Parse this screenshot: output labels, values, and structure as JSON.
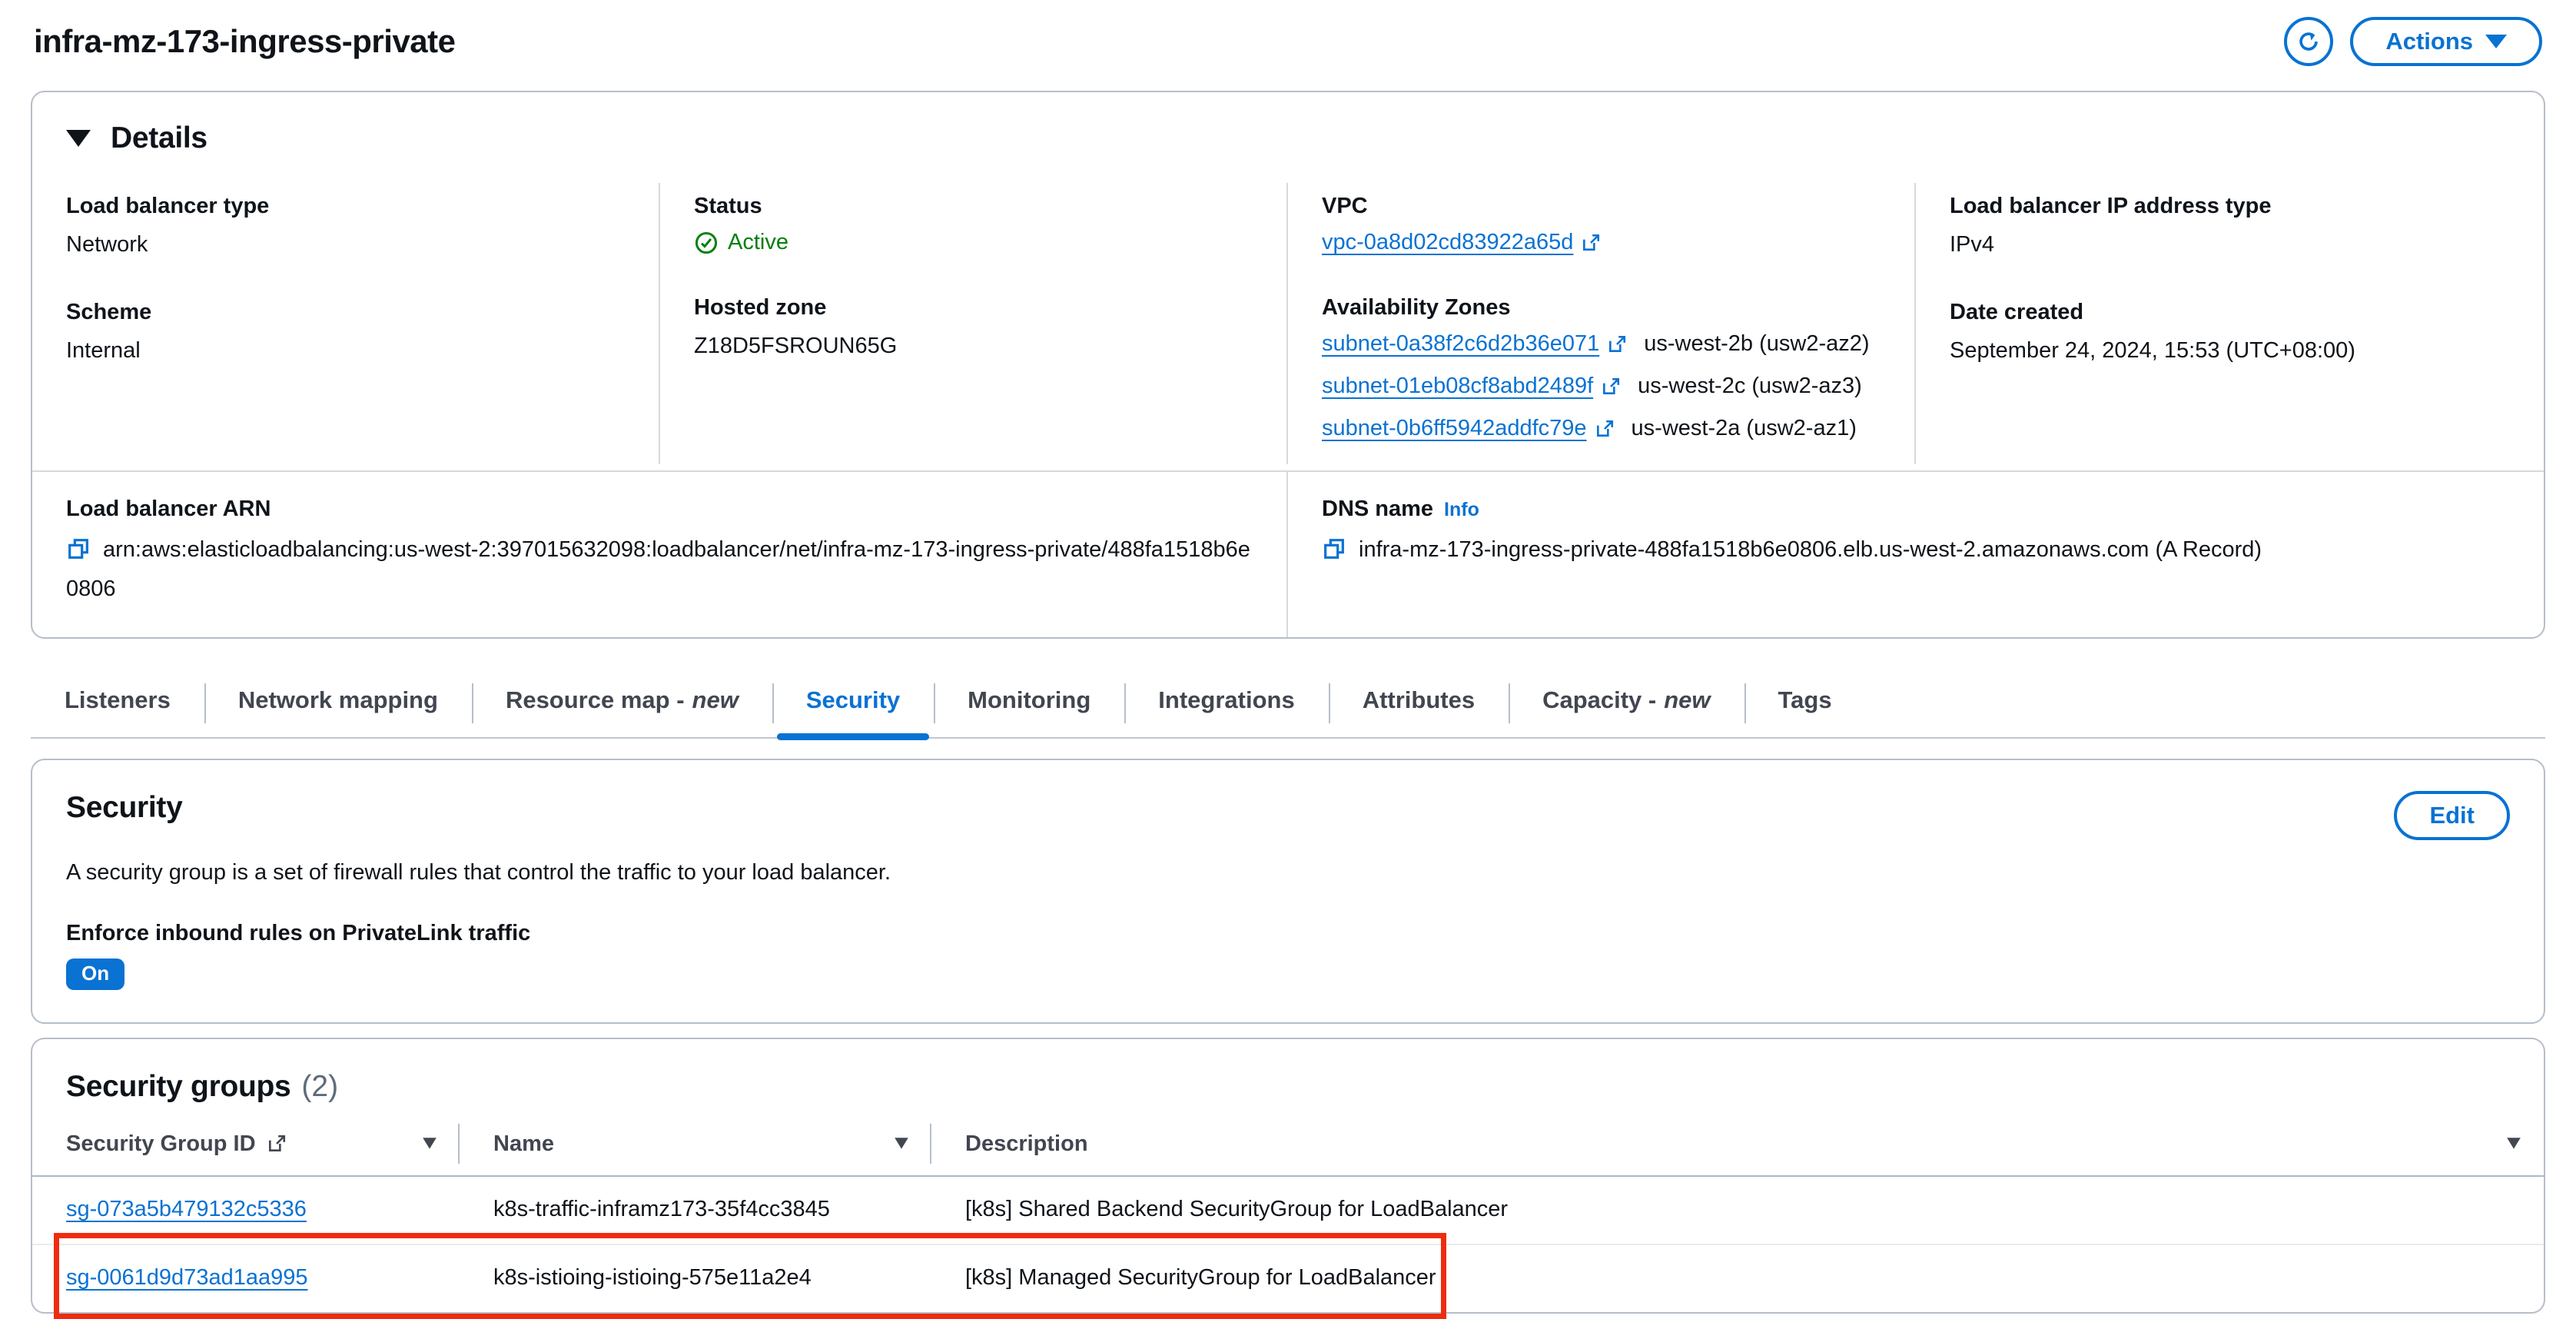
{
  "page": {
    "title": "infra-mz-173-ingress-private"
  },
  "toolbar": {
    "actions_label": "Actions"
  },
  "icons": {
    "refresh": "refresh-icon",
    "caret_down": "caret-down-icon",
    "collapse_triangle": "triangle-down-icon",
    "status_check": "check-circle-icon",
    "external_link": "external-link-icon",
    "copy": "copy-icon",
    "sort": "sort-triangle-icon"
  },
  "colors": {
    "accent_blue": "#0972d3",
    "status_green": "#037f0c",
    "annotation_red": "#ee2d10"
  },
  "details": {
    "title": "Details",
    "load_balancer_type": {
      "label": "Load balancer type",
      "value": "Network"
    },
    "scheme": {
      "label": "Scheme",
      "value": "Internal"
    },
    "status": {
      "label": "Status",
      "value": "Active"
    },
    "hosted_zone": {
      "label": "Hosted zone",
      "value": "Z18D5FSROUN65G"
    },
    "vpc": {
      "label": "VPC",
      "link": "vpc-0a8d02cd83922a65d"
    },
    "availability_zones": {
      "label": "Availability Zones",
      "items": [
        {
          "subnet": "subnet-0a38f2c6d2b36e071",
          "zone": "us-west-2b (usw2-az2)"
        },
        {
          "subnet": "subnet-01eb08cf8abd2489f",
          "zone": "us-west-2c (usw2-az3)"
        },
        {
          "subnet": "subnet-0b6ff5942addfc79e",
          "zone": "us-west-2a (usw2-az1)"
        }
      ]
    },
    "ip_address_type": {
      "label": "Load balancer IP address type",
      "value": "IPv4"
    },
    "date_created": {
      "label": "Date created",
      "value": "September 24, 2024, 15:53 (UTC+08:00)"
    },
    "arn": {
      "label": "Load balancer ARN",
      "value": "arn:aws:elasticloadbalancing:us-west-2:397015632098:loadbalancer/net/infra-mz-173-ingress-private/488fa1518b6e0806"
    },
    "dns": {
      "label": "DNS name",
      "info": "Info",
      "value": "infra-mz-173-ingress-private-488fa1518b6e0806.elb.us-west-2.amazonaws.com (A Record)"
    }
  },
  "tabs": [
    {
      "label": "Listeners"
    },
    {
      "label": "Network mapping"
    },
    {
      "label": "Resource map -",
      "suffix": "new"
    },
    {
      "label": "Security",
      "active": true
    },
    {
      "label": "Monitoring"
    },
    {
      "label": "Integrations"
    },
    {
      "label": "Attributes"
    },
    {
      "label": "Capacity -",
      "suffix": "new"
    },
    {
      "label": "Tags"
    }
  ],
  "security": {
    "title": "Security",
    "description": "A security group is a set of firewall rules that control the traffic to your load balancer.",
    "enforce_label": "Enforce inbound rules on PrivateLink traffic",
    "enforce_value": "On",
    "edit_label": "Edit"
  },
  "security_groups": {
    "title": "Security groups",
    "count": "(2)",
    "columns": [
      "Security Group ID",
      "Name",
      "Description"
    ],
    "rows": [
      {
        "id": "sg-073a5b479132c5336",
        "name": "k8s-traffic-inframz173-35f4cc3845",
        "description": "[k8s] Shared Backend SecurityGroup for LoadBalancer"
      },
      {
        "id": "sg-0061d9d73ad1aa995",
        "name": "k8s-istioing-istioing-575e11a2e4",
        "description": "[k8s] Managed SecurityGroup for LoadBalancer"
      }
    ]
  }
}
